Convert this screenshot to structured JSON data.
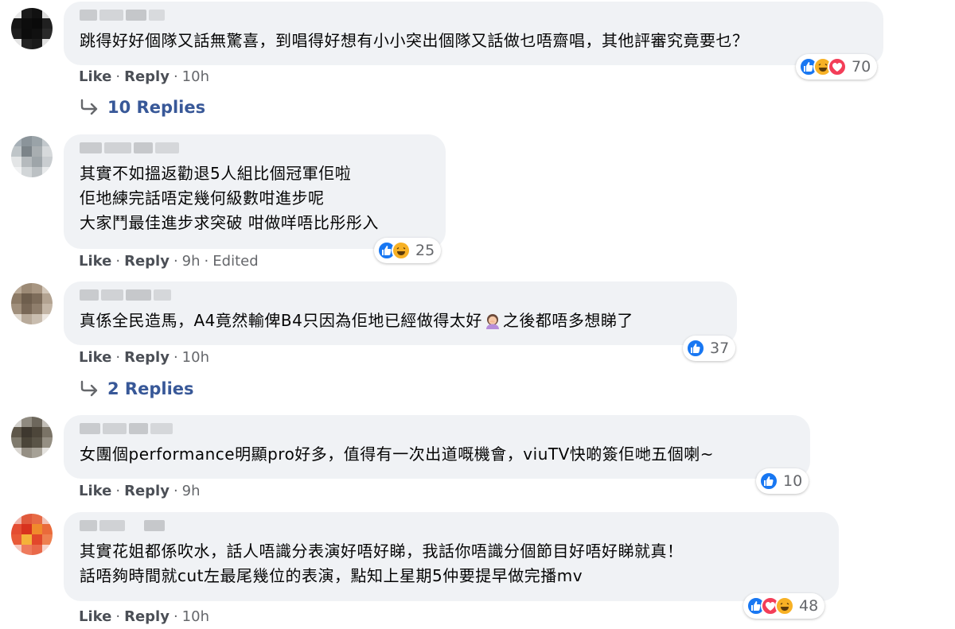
{
  "comments": [
    {
      "text": "跳得好好個隊又話無驚喜，到唱得好想有小小突出個隊又話做乜唔齋唱，其他評審究竟要乜？",
      "reactions": [
        "like-icon",
        "haha-icon",
        "love-icon"
      ],
      "reaction_count": "70",
      "actions": {
        "like": "Like",
        "reply": "Reply",
        "time": "10h"
      },
      "replies_label": "10 Replies"
    },
    {
      "text": "其實不如搵返勸退5人組比個冠軍佢啦\n佢地練完話唔定幾何級數咁進步呢\n大家鬥最佳進步求突破 咁做咩唔比彤彤入",
      "reactions": [
        "like-icon",
        "haha-icon"
      ],
      "reaction_count": "25",
      "actions": {
        "like": "Like",
        "reply": "Reply",
        "time": "9h",
        "edited": "Edited"
      }
    },
    {
      "text_before": "真係全民造馬，A4竟然輸俾B4只因為佢地已經做得太好",
      "text_after": "之後都唔多想睇了",
      "emoji": "woman-facepalming-icon",
      "reactions": [
        "like-icon"
      ],
      "reaction_count": "37",
      "actions": {
        "like": "Like",
        "reply": "Reply",
        "time": "10h"
      },
      "replies_label": "2 Replies"
    },
    {
      "text": "女團個performance明顯pro好多，值得有一次出道嘅機會，viuTV快啲簽佢哋五個喇~",
      "reactions": [
        "like-icon"
      ],
      "reaction_count": "10",
      "actions": {
        "like": "Like",
        "reply": "Reply",
        "time": "9h"
      }
    },
    {
      "text": "其實花姐都係吹水，話人唔識分表演好唔好睇，我話你唔識分個節目好唔好睇就真！\n話唔夠時間就cut左最尾幾位的表演，點知上星期5仲要提早做完播mv",
      "reactions": [
        "like-icon",
        "love-icon",
        "haha-icon"
      ],
      "reaction_count": "48",
      "actions": {
        "like": "Like",
        "reply": "Reply",
        "time": "10h"
      }
    }
  ],
  "colors": {
    "bubble": "#f0f2f5",
    "like_blue": "#1877f2",
    "love_red": "#f33e58",
    "haha_yellow": "#f7b125",
    "link": "#385898",
    "meta": "#65676b"
  }
}
